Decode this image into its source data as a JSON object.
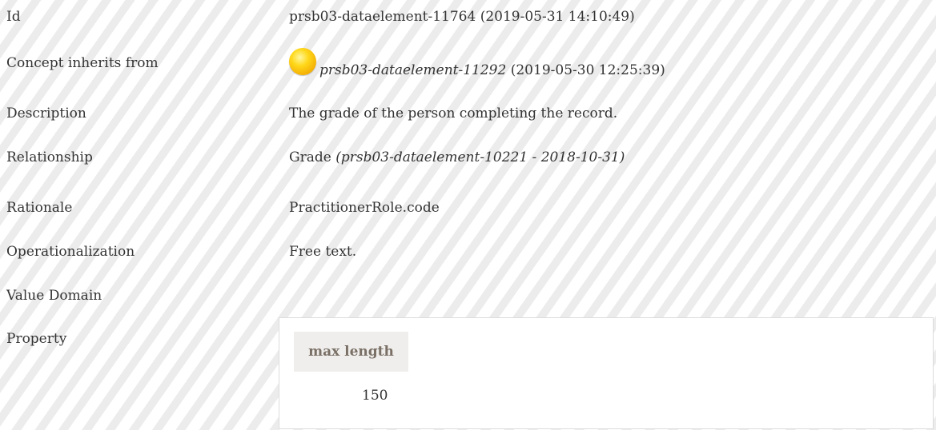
{
  "rows": {
    "id": {
      "label": "Id",
      "value": "prsb03-dataelement-11764 (2019-05-31 14:10:49)"
    },
    "inherits": {
      "label": "Concept inherits from",
      "ref": "prsb03-dataelement-11292",
      "date": "(2019-05-30 12:25:39)",
      "status_icon": "status-circle-icon",
      "status_color": "#ffcc00"
    },
    "description": {
      "label": "Description",
      "value": "The grade of the person completing the record."
    },
    "relationship": {
      "label": "Relationship",
      "name": "Grade",
      "ref": "(prsb03-dataelement-10221 - 2018-10-31)"
    },
    "rationale": {
      "label": "Rationale",
      "value": "PractitionerRole.code"
    },
    "operationalization": {
      "label": "Operationalization",
      "value": "Free text."
    },
    "value_domain": {
      "label": "Value Domain"
    },
    "property": {
      "label": "Property",
      "header": "max length",
      "value": "150"
    }
  }
}
